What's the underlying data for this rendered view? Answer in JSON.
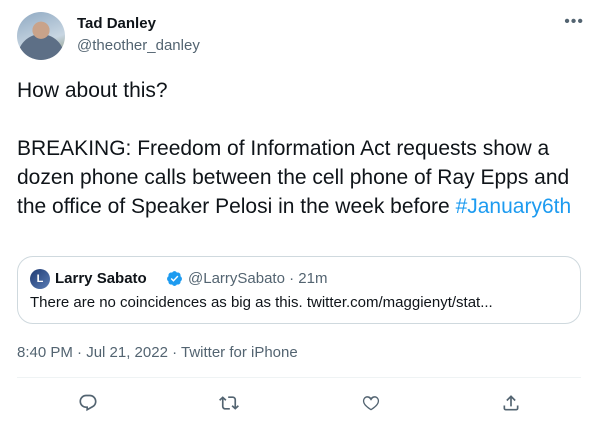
{
  "author": {
    "name": "Tad Danley",
    "handle": "@theother_danley"
  },
  "more_label": "•••",
  "tweet": {
    "text": "How about this?\n\nBREAKING: Freedom of Information Act requests show a dozen phone calls between the cell phone of Ray Epps and the office of Speaker Pelosi in the week before ",
    "hashtag": "#January6th"
  },
  "quote": {
    "avatar_initial": "L",
    "name": "Larry Sabato",
    "meta": "@LarrySabato · 21m",
    "text": "There are no coincidences as big as this. twitter.com/maggienyt/stat..."
  },
  "footer": {
    "timestamp": "8:40 PM · Jul 21, 2022 · Twitter for iPhone"
  },
  "actions": [
    "reply-icon",
    "retweet-icon",
    "like-icon",
    "share-icon"
  ],
  "colors": {
    "link": "#1d9bf0",
    "secondary_text": "#536471",
    "border": "#cfd9de"
  }
}
